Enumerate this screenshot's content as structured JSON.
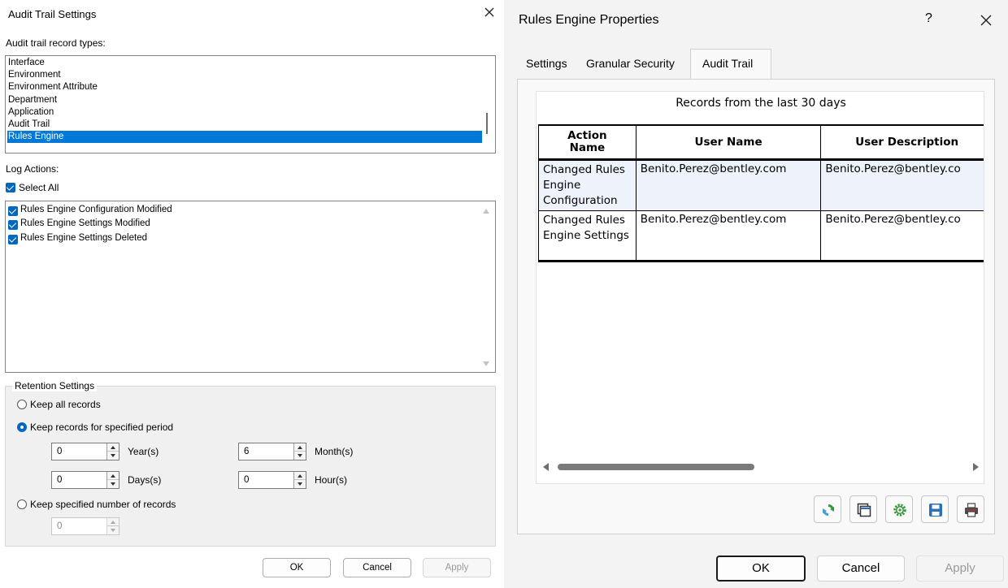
{
  "audit": {
    "title": "Audit Trail Settings",
    "record_types_label": "Audit trail record types:",
    "record_types": [
      "Interface",
      "Environment",
      "Environment Attribute",
      "Department",
      "Application",
      "Audit Trail",
      "Rules Engine"
    ],
    "selected_record_type": "Rules Engine",
    "log_actions_label": "Log Actions:",
    "select_all_label": "Select All",
    "actions": [
      "Rules Engine Configuration Modified",
      "Rules Engine Settings Modified",
      "Rules Engine Settings Deleted"
    ],
    "retention": {
      "legend": "Retention Settings",
      "keep_all": "Keep all records",
      "keep_period": "Keep records for specified period",
      "keep_number": "Keep specified number of records",
      "selected_option": "Keep records for specified period",
      "years_value": "0",
      "years_label": "Year(s)",
      "months_value": "6",
      "months_label": "Month(s)",
      "days_value": "0",
      "days_label": "Days(s)",
      "hours_value": "0",
      "hours_label": "Hour(s)",
      "records_value": "0"
    },
    "buttons": {
      "ok": "OK",
      "cancel": "Cancel",
      "apply": "Apply"
    }
  },
  "rules": {
    "title": "Rules Engine Properties",
    "help": "?",
    "tabs": [
      "Settings",
      "Granular Security",
      "Audit Trail"
    ],
    "active_tab": "Audit Trail",
    "report_title": "Records from the last 30 days",
    "columns": [
      "Action Name",
      "User Name",
      "User Description"
    ],
    "rows": [
      {
        "action": "Changed Rules Engine Configuration",
        "user": "Benito.Perez@bentley.com",
        "description": "Benito.Perez@bentley.co"
      },
      {
        "action": "Changed Rules Engine Settings",
        "user": "Benito.Perez@bentley.com",
        "description": "Benito.Perez@bentley.co"
      }
    ],
    "toolbar_icons": [
      "refresh-icon",
      "copy-icon",
      "settings-icon",
      "save-icon",
      "print-icon"
    ],
    "buttons": {
      "ok": "OK",
      "cancel": "Cancel",
      "apply": "Apply"
    }
  }
}
